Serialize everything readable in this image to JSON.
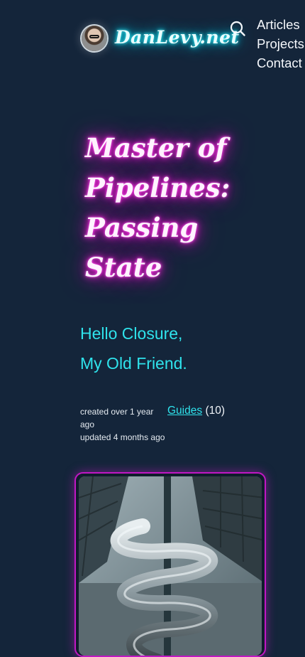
{
  "header": {
    "site_name": "DanLevy.net",
    "nav": [
      "Articles",
      "Projects",
      "Contact"
    ]
  },
  "article": {
    "title": "Master of Pipelines: Passing State",
    "subtitle_lines": [
      "Hello Closure,",
      "My Old Friend."
    ],
    "created": "created over 1 year ago",
    "updated": "updated 4 months ago",
    "category": {
      "label": "Guides",
      "count": "(10)"
    }
  },
  "colors": {
    "background": "#14253a",
    "cyan_neon": "#2fe3ec",
    "magenta_neon": "#ff1fdc"
  },
  "icons": [
    "avatar",
    "search-icon"
  ]
}
